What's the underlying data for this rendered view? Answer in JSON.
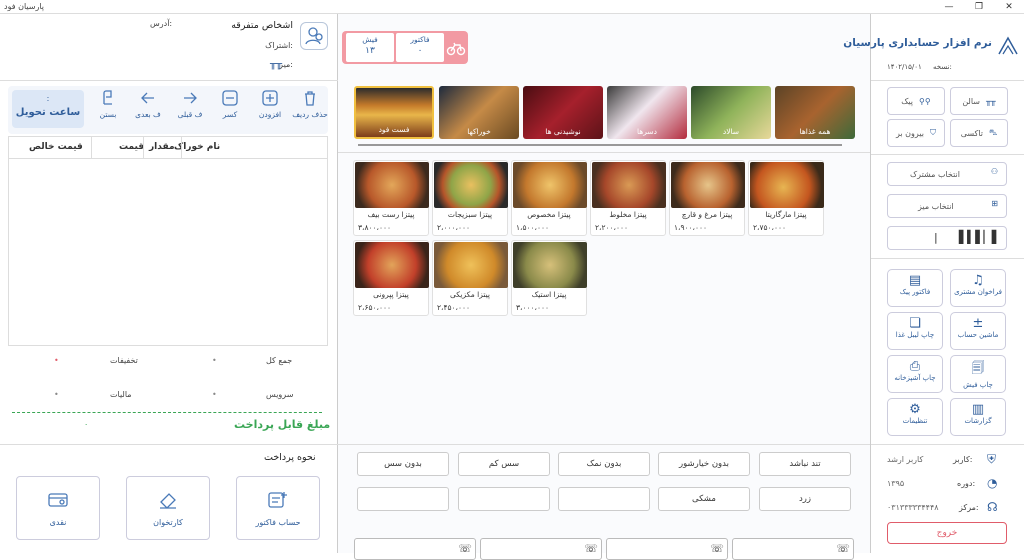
{
  "window": {
    "title": "پارسیان فود",
    "min": "—",
    "max": "❐",
    "close": "✕"
  },
  "customer": {
    "name": "اشخاص متفرقه",
    "address_label": "آدرس:",
    "subscription_label": "اشتراک:",
    "table_label": "میز:"
  },
  "counters": {
    "invoice_label": "فاکتور",
    "invoice_value": "۰",
    "receipt_label": "فیش",
    "receipt_value": "۱۳"
  },
  "toolbar": {
    "delete_row": "حذف ردیف",
    "add": "افزودن",
    "reduce": "کسر",
    "prev_receipt": "ف قبلی",
    "next_receipt": "ف بعدی",
    "close": "بستن",
    "delivery_time": "ساعت تحویل",
    "delivery_value": ":"
  },
  "order_table": {
    "headers": [
      "نام خوراک",
      "مقدار",
      "قیمت",
      "قیمت خالص"
    ]
  },
  "totals": {
    "total_label": "جمع کل",
    "discount_label": "تخفیفات",
    "service_label": "سرویس",
    "tax_label": "مالیات",
    "payable_label": "مبلغ قابل پرداخت",
    "payable_value": "۰"
  },
  "payment": {
    "title": "نحوه پرداخت",
    "invoice_account": "حساب فاکتور",
    "card": "کارتخوان",
    "cash": "نقدی"
  },
  "categories": [
    {
      "label": "همه غذاها"
    },
    {
      "label": "سالاد"
    },
    {
      "label": "دسرها"
    },
    {
      "label": "نوشیدنی ها"
    },
    {
      "label": "خوراکها"
    },
    {
      "label": "فست فود"
    }
  ],
  "foods": [
    {
      "name": "پیتزا مارگاریتا",
      "price": "۲،۷۵۰،۰۰۰"
    },
    {
      "name": "پیتزا مرغ و قارچ",
      "price": "۱،۹۰۰،۰۰۰"
    },
    {
      "name": "پیتزا مخلوط",
      "price": "۲،۲۰۰،۰۰۰"
    },
    {
      "name": "پیتزا مخصوص",
      "price": "۱،۵۰۰،۰۰۰"
    },
    {
      "name": "پیتزا سبزیجات",
      "price": "۲،۰۰۰،۰۰۰"
    },
    {
      "name": "پیتزا رست بیف",
      "price": "۳،۸۰۰،۰۰۰"
    },
    {
      "name": "پیتزا استیک",
      "price": "۳،۰۰۰،۰۰۰"
    },
    {
      "name": "پیتزا مکزیکی",
      "price": "۲،۴۵۰،۰۰۰"
    },
    {
      "name": "پیتزا پپرونی",
      "price": "۲،۶۵۰،۰۰۰"
    }
  ],
  "options": [
    "تند نباشد",
    "بدون خیارشور",
    "بدون نمک",
    "سس کم",
    "بدون سس",
    "زرد",
    "مشکی",
    "",
    "",
    ""
  ],
  "brand": {
    "name": "نرم افزار حسابداری پارسیان",
    "version_label": "نسخه:",
    "version": "۱۴۰۲/۱۵/۰۱"
  },
  "order_types": {
    "salon": "سالن",
    "peyk": "پیک",
    "taxi": "تاکسی",
    "outside": "بیرون بر"
  },
  "selectors": {
    "customer": "انتخاب مشترک",
    "table": "انتخاب میز",
    "barcode_value": "|"
  },
  "functions": {
    "call_customer": "فراخوان مشتری",
    "peyk_invoice": "فاکتور پیک",
    "calculator": "ماشین حساب",
    "print_food_label": "چاپ لیبل غذا",
    "print_receipt": "چاپ فیش",
    "print_kitchen": "چاپ آشپزخانه",
    "reports": "گزارشات",
    "settings": "تنظیمات"
  },
  "status": {
    "user_label": "کاربر:",
    "user_value": "کاربر ارشد",
    "period_label": "دوره:",
    "period_value": "۱۳۹۵",
    "center_label": "مرکز:",
    "center_value": "۰۳۱۳۳۳۳۳۴۴۴۸",
    "exit": "خروج"
  },
  "colors": {
    "accent": "#2f5d9a",
    "green": "#3aa655",
    "red": "#e05c6a",
    "counter_bg": "#f29aa3"
  }
}
